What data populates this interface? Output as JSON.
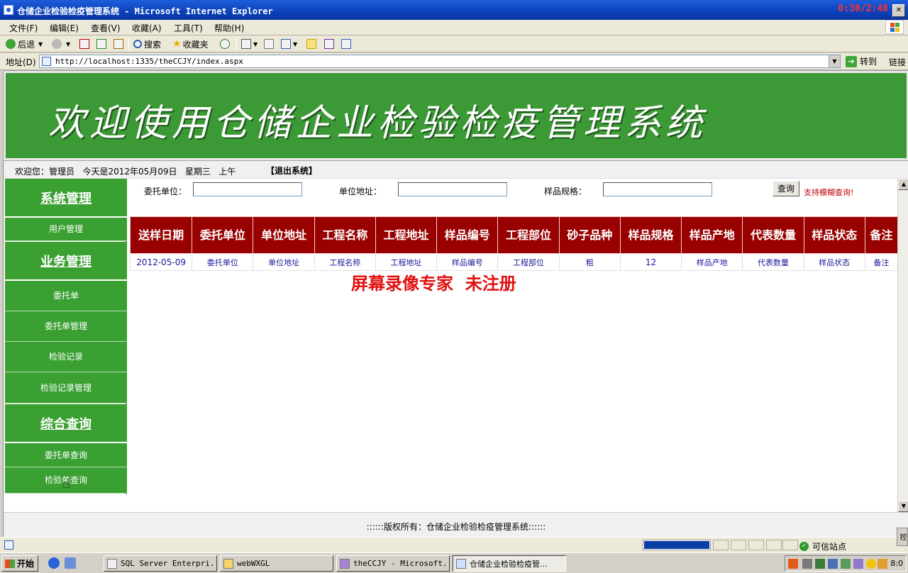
{
  "window": {
    "title": "仓储企业检验检疫管理系统 - Microsoft Internet Explorer",
    "timer": "0:30/2:48"
  },
  "menu": [
    "文件(F)",
    "编辑(E)",
    "查看(V)",
    "收藏(A)",
    "工具(T)",
    "帮助(H)"
  ],
  "toolbar": {
    "back": "后退",
    "search": "搜索",
    "favorites": "收藏夹"
  },
  "address": {
    "label": "地址(D)",
    "url": "http://localhost:1335/theCCJY/index.aspx",
    "go": "转到",
    "links": "链接"
  },
  "banner": {
    "text": "欢迎使用仓储企业检验检疫管理系统"
  },
  "infobar": {
    "welcome": "欢迎您：管理员   今天是2012年05月09日   星期三   上午",
    "logout": "【退出系统】"
  },
  "sidebar": {
    "sections": [
      {
        "title": "系统管理",
        "items": [
          "用户管理"
        ]
      },
      {
        "title": "业务管理",
        "items": [
          "委托单",
          "委托单管理",
          "检验记录",
          "检验记录管理"
        ]
      },
      {
        "title": "综合查询",
        "items": [
          "委托单查询",
          "检验单查询"
        ]
      }
    ]
  },
  "search": {
    "client_label": "委托单位：",
    "address_label": "单位地址：",
    "spec_label": "样品规格：",
    "client_value": "",
    "address_value": "",
    "spec_value": "",
    "button": "查询",
    "hint": "支持模糊查询!"
  },
  "table": {
    "headers": [
      "送样日期",
      "委托单位",
      "单位地址",
      "工程名称",
      "工程地址",
      "样品编号",
      "工程部位",
      "砂子品种",
      "样品规格",
      "样品产地",
      "代表数量",
      "样品状态",
      "备注"
    ],
    "rows": [
      [
        "2012-05-09",
        "委托单位",
        "单位地址",
        "工程名称",
        "工程地址",
        "样品编号",
        "工程部位",
        "粗",
        "12",
        "样品产地",
        "代表数量",
        "样品状态",
        "备注"
      ]
    ]
  },
  "watermark": "屏幕录像专家  未注册",
  "footer": "::::::版权所有：仓储企业检验检疫管理系统::::::",
  "statusbar": {
    "zone": "可信站点",
    "progress": 0.98
  },
  "taskbar": {
    "start": "开始",
    "tasks": [
      "SQL Server Enterpri...",
      "webWXGL",
      "theCCJY - Microsoft...",
      "仓储企业检验检疫管..."
    ],
    "clock": "8:0"
  }
}
